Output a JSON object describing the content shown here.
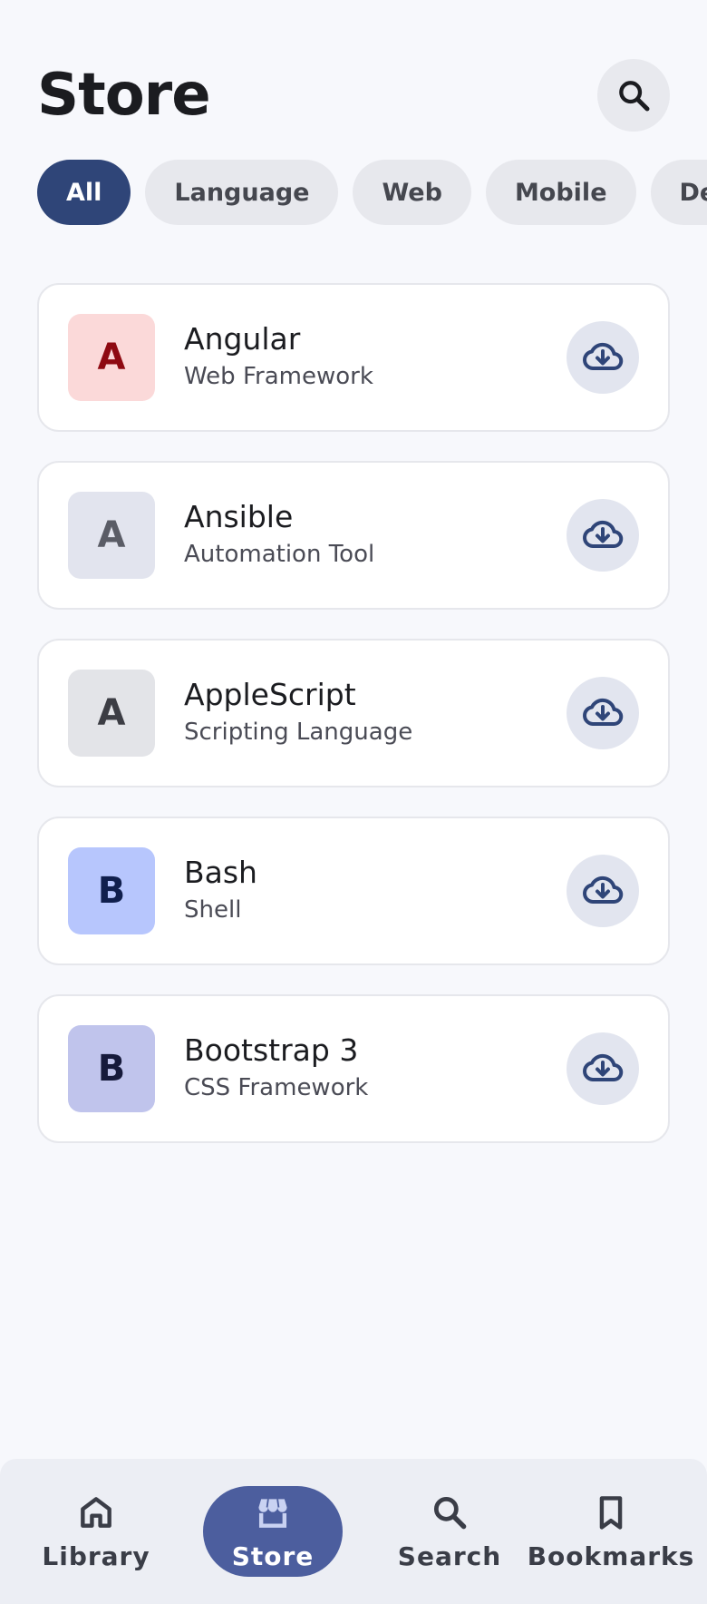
{
  "header": {
    "title": "Store",
    "search_icon": "search-icon"
  },
  "filters": [
    {
      "label": "All",
      "active": true
    },
    {
      "label": "Language",
      "active": false
    },
    {
      "label": "Web",
      "active": false
    },
    {
      "label": "Mobile",
      "active": false
    },
    {
      "label": "DevOps",
      "active": false
    }
  ],
  "items": [
    {
      "initial": "A",
      "name": "Angular",
      "category": "Web Framework",
      "avatar_bg": "#fbd9d9",
      "avatar_fg": "#8e0a12",
      "action_icon": "cloud-download-icon"
    },
    {
      "initial": "A",
      "name": "Ansible",
      "category": "Automation Tool",
      "avatar_bg": "#e2e4ee",
      "avatar_fg": "#5a5c66",
      "action_icon": "cloud-download-icon"
    },
    {
      "initial": "A",
      "name": "AppleScript",
      "category": "Scripting Language",
      "avatar_bg": "#e3e4e8",
      "avatar_fg": "#3c3d44",
      "action_icon": "cloud-download-icon"
    },
    {
      "initial": "B",
      "name": "Bash",
      "category": "Shell",
      "avatar_bg": "#b7c6fd",
      "avatar_fg": "#101f4d",
      "action_icon": "cloud-download-icon"
    },
    {
      "initial": "B",
      "name": "Bootstrap 3",
      "category": "CSS Framework",
      "avatar_bg": "#c0c4ec",
      "avatar_fg": "#161a3b",
      "action_icon": "cloud-download-icon"
    }
  ],
  "bottom_nav": [
    {
      "label": "Library",
      "icon": "home-icon",
      "active": false
    },
    {
      "label": "Store",
      "icon": "store-icon",
      "active": true
    },
    {
      "label": "Search",
      "icon": "search-icon",
      "active": false
    },
    {
      "label": "Bookmarks",
      "icon": "bookmark-icon",
      "active": false
    }
  ],
  "colors": {
    "accent": "#2f4578",
    "nav_active": "#4c5e9e",
    "icon": "#2f4578"
  }
}
